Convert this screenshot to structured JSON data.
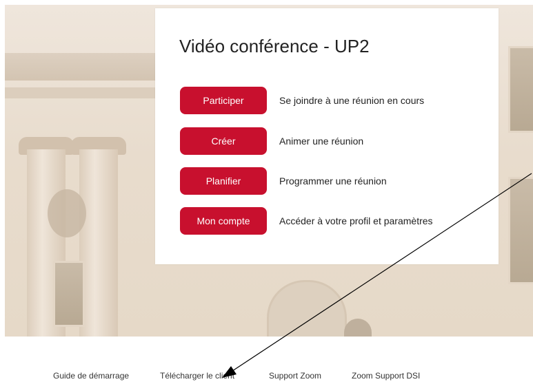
{
  "card": {
    "title": "Vidéo conférence - UP2",
    "actions": [
      {
        "button": "Participer",
        "description": "Se joindre à une réunion en cours"
      },
      {
        "button": "Créer",
        "description": "Animer une réunion"
      },
      {
        "button": "Planifier",
        "description": "Programmer une réunion"
      },
      {
        "button": "Mon compte",
        "description": "Accéder à votre profil et paramètres"
      }
    ]
  },
  "footer": {
    "links": [
      "Guide de démarrage",
      "Télécharger le client",
      "Support Zoom",
      "Zoom Support DSI"
    ]
  },
  "colors": {
    "accent": "#c8102e",
    "card_bg": "#ffffff",
    "text": "#222222"
  },
  "icons": {
    "annotation": "arrow-pointer-icon"
  }
}
